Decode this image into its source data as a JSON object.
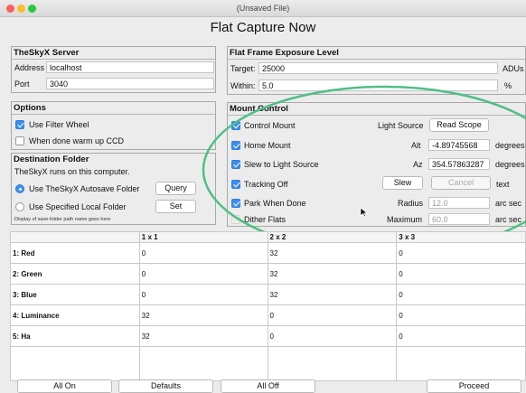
{
  "window": {
    "title": "(Unsaved File)",
    "app_title": "Flat Capture Now"
  },
  "server": {
    "title": "TheSkyX Server",
    "address_label": "Address",
    "address_value": "localhost",
    "port_label": "Port",
    "port_value": "3040"
  },
  "options": {
    "title": "Options",
    "filter_wheel": "Use Filter Wheel",
    "warm_ccd": "When done warm up CCD"
  },
  "destination": {
    "title": "Destination Folder",
    "note": "TheSkyX runs on this computer.",
    "autosave_label": "Use TheSkyX Autosave Folder",
    "query_label": "Query",
    "local_label": "Use Specified Local Folder",
    "set_label": "Set",
    "path_note": "Display of save-folder path name goes here"
  },
  "exposure": {
    "title": "Flat Frame Exposure Level",
    "target_label": "Target:",
    "target_value": "25000",
    "target_unit": "ADUs",
    "within_label": "Within:",
    "within_value": "5.0",
    "within_unit": "%"
  },
  "mount": {
    "title": "Mount Control",
    "control_mount": "Control Mount",
    "home_mount": "Home Mount",
    "slew_to_light": "Slew to Light Source",
    "tracking_off": "Tracking Off",
    "park_when_done": "Park When Done",
    "dither_flats": "Dither Flats",
    "light_source_label": "Light Source",
    "read_scope": "Read Scope",
    "alt_label": "Alt",
    "alt_value": "-4.89745568",
    "alt_unit": "degrees",
    "az_label": "Az",
    "az_value": "354.57863287",
    "az_unit": "degrees",
    "slew_label": "Slew",
    "cancel_label": "Cancel",
    "text_label": "text",
    "radius_label": "Radius",
    "radius_value": "12.0",
    "radius_unit": "arc sec",
    "maximum_label": "Maximum",
    "maximum_value": "60.0",
    "maximum_unit": "arc sec"
  },
  "table": {
    "columns": [
      "",
      "1 x 1",
      "2 x 2",
      "3 x 3"
    ],
    "rows": [
      [
        "1: Red",
        "0",
        "32",
        "0"
      ],
      [
        "2: Green",
        "0",
        "32",
        "0"
      ],
      [
        "3: Blue",
        "0",
        "32",
        "0"
      ],
      [
        "4: Luminance",
        "32",
        "0",
        "0"
      ],
      [
        "5: Ha",
        "32",
        "0",
        "0"
      ]
    ]
  },
  "buttons": {
    "all_on": "All On",
    "defaults": "Defaults",
    "all_off": "All Off",
    "proceed": "Proceed"
  },
  "colors": {
    "accent": "#3b8ff0",
    "annotation_ellipse": "#4fbf86"
  }
}
